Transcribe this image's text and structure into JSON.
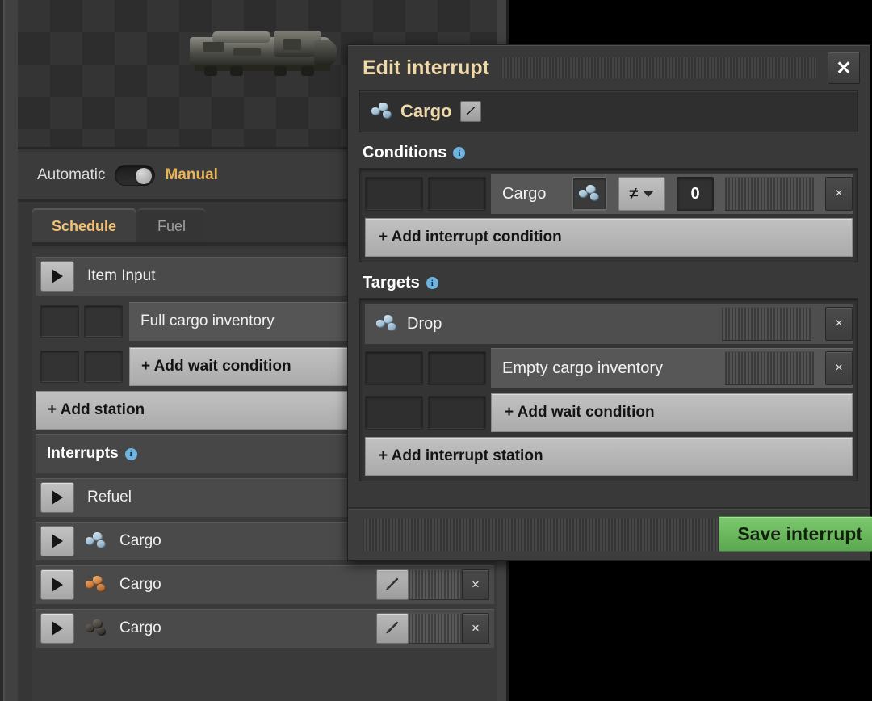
{
  "train_panel": {
    "preview": {
      "icon": "locomotive-sprite"
    },
    "mode": {
      "automatic_label": "Automatic",
      "manual_label": "Manual",
      "selected": "Manual"
    },
    "tabs": [
      {
        "label": "Schedule",
        "active": true
      },
      {
        "label": "Fuel",
        "active": false
      }
    ],
    "schedule": {
      "stations": [
        {
          "name": "Item Input",
          "icon": "play-triangle-icon",
          "conditions": [
            {
              "text": "Full cargo inventory"
            }
          ],
          "add_wait_label": "+ Add wait condition"
        }
      ],
      "add_station_label": "+ Add station",
      "interrupts_header": "Interrupts",
      "interrupts_info": "i",
      "interrupts": [
        {
          "name": "Refuel",
          "icon": null,
          "editing": false,
          "has_controls": false
        },
        {
          "name": "Cargo",
          "icon": "iron-ore-icon",
          "icon_color": "#9fc4dc",
          "editing": true,
          "has_controls": true
        },
        {
          "name": "Cargo",
          "icon": "copper-ore-icon",
          "icon_color": "#d98a4e",
          "editing": false,
          "has_controls": true
        },
        {
          "name": "Cargo",
          "icon": "coal-icon",
          "icon_color": "#4a453f",
          "editing": false,
          "has_controls": true
        }
      ]
    }
  },
  "dialog": {
    "title": "Edit interrupt",
    "close_label": "✕",
    "interrupt_name": "Cargo",
    "interrupt_icon": "iron-ore-icon",
    "rename_icon": "pencil-icon",
    "conditions": {
      "label": "Conditions",
      "info": "i",
      "rows": [
        {
          "signal_label": "Cargo",
          "signal_icon": "iron-ore-icon",
          "comparator": "≠",
          "value": "0",
          "remove_label": "×"
        }
      ],
      "add_label": "+ Add interrupt condition"
    },
    "targets": {
      "label": "Targets",
      "info": "i",
      "stations": [
        {
          "name": "Drop",
          "icon": "iron-ore-icon",
          "remove_label": "×",
          "wait_conditions": [
            {
              "text": "Empty cargo inventory",
              "remove_label": "×"
            }
          ],
          "add_wait_label": "+ Add wait condition"
        }
      ],
      "add_station_label": "+ Add interrupt station"
    },
    "save_label": "Save interrupt"
  },
  "colors": {
    "accent_gold": "#f0d9a8",
    "save_green": "#6fbf63",
    "info_blue": "#6db4e0",
    "highlight_orange": "#e3ad3e"
  }
}
